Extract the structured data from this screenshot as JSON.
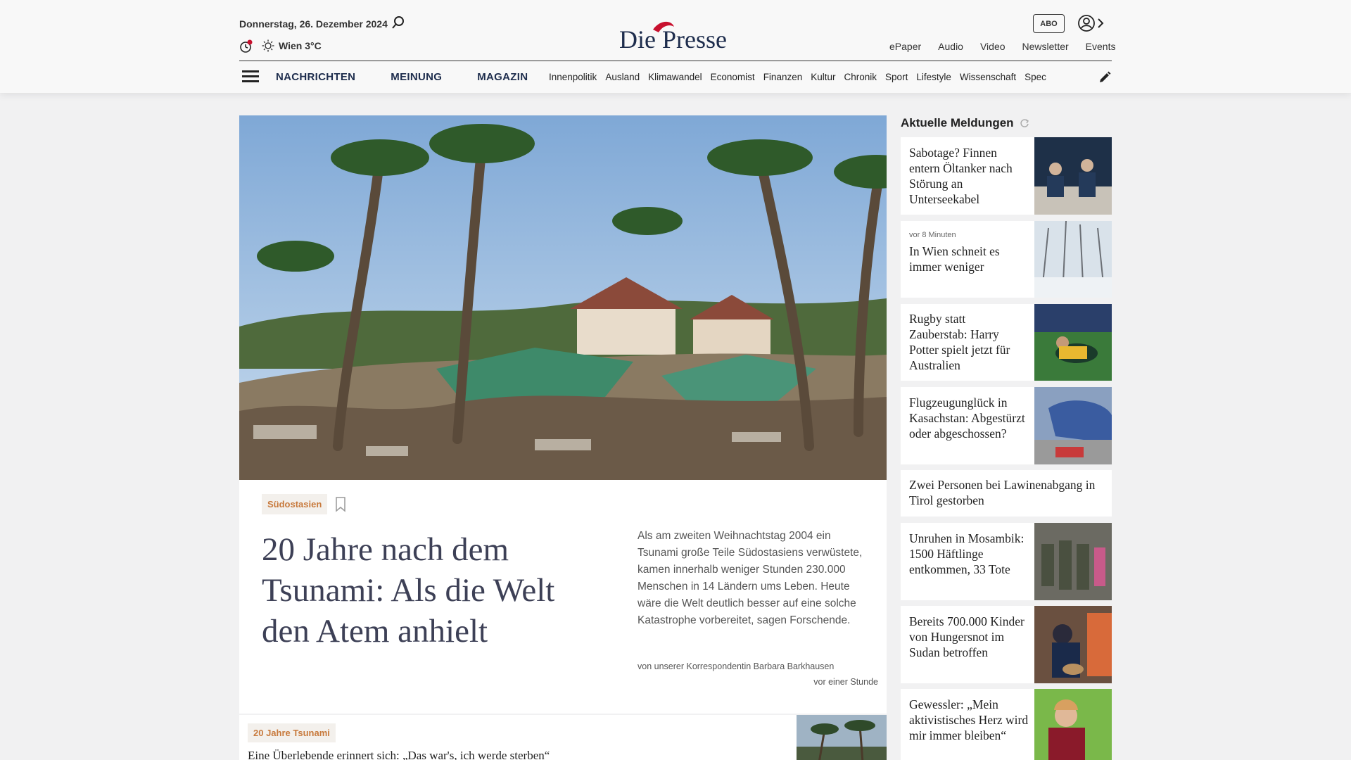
{
  "header": {
    "date": "Donnerstag, 26. Dezember 2024",
    "weather": "Wien 3°C",
    "logo_text": "Die Presse",
    "abo_label": "ABO",
    "top_links": [
      "ePaper",
      "Audio",
      "Video",
      "Newsletter",
      "Events"
    ],
    "main_nav": [
      "NACHRICHTEN",
      "MEINUNG",
      "MAGAZIN"
    ],
    "sub_nav": [
      "Innenpolitik",
      "Ausland",
      "Klimawandel",
      "Economist",
      "Finanzen",
      "Kultur",
      "Chronik",
      "Sport",
      "Lifestyle",
      "Wissenschaft",
      "Spec"
    ]
  },
  "lead_article": {
    "tag": "Südostasien",
    "headline": "20 Jahre nach dem Tsunami: Als die Welt den Atem anhielt",
    "teaser": "Als am zweiten Weihnachtstag 2004 ein Tsunami große Teile Südostasiens verwüstete, kamen innerhalb weniger Stunden 230.000 Menschen in 14 Ländern ums Leben. Heute wäre die Welt deutlich besser auf eine solche Katastrophe vorbereitet, sagen Forschende.",
    "byline": "von unserer Korrespondentin Barbara Barkhausen",
    "time": "vor einer Stunde"
  },
  "second_article": {
    "tag": "20 Jahre Tsunami",
    "headline": "Eine Überlebende erinnert sich: „Das war's, ich werde sterben“"
  },
  "sidebar": {
    "title": "Aktuelle Meldungen",
    "items": [
      {
        "title": "Sabotage? Finnen entern Öltanker nach Störung an Unterseekabel",
        "timestamp": ""
      },
      {
        "title": "In Wien schneit es immer weniger",
        "timestamp": "vor 8 Minuten"
      },
      {
        "title": "Rugby statt Zauberstab: Harry Potter spielt jetzt für Australien",
        "timestamp": ""
      },
      {
        "title": "Flugzeugunglück in Kasachstan: Abgestürzt oder abgeschossen?",
        "timestamp": ""
      },
      {
        "title": "Zwei Personen bei Lawinenabgang in Tirol gestorben",
        "timestamp": ""
      },
      {
        "title": "Unruhen in Mosambik: 1500 Häftlinge entkommen, 33 Tote",
        "timestamp": ""
      },
      {
        "title": "Bereits 700.000 Kinder von Hungersnot im Sudan betroffen",
        "timestamp": ""
      },
      {
        "title": "Gewessler: „Mein aktivistisches Herz wird mir immer bleiben“",
        "timestamp": ""
      }
    ]
  },
  "colors": {
    "brand_red": "#c8102e",
    "nav_blue": "#1e2d4d",
    "tag_orange": "#c87a3d"
  }
}
